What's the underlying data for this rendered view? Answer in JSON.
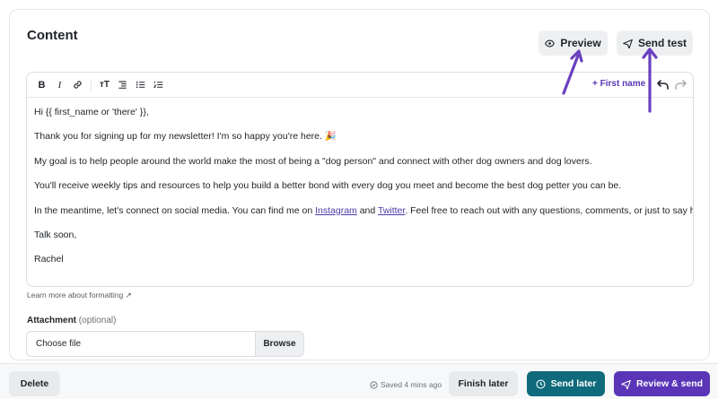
{
  "section": {
    "title": "Content"
  },
  "header_buttons": {
    "preview": "Preview",
    "send_test": "Send test"
  },
  "toolbar": {
    "bold": "B",
    "italic": "I",
    "text_size": "тT",
    "personalize": "+ First name"
  },
  "editor": {
    "paragraphs": [
      "Hi {{ first_name or 'there' }},",
      "Thank you for signing up for my newsletter! I'm so happy you're here. 🎉",
      "My goal is to help people around the world make the most of being a \"dog person\" and connect with other dog owners and dog lovers.",
      "You'll receive weekly tips and resources to help you build a better bond with every dog you meet and become the best dog petter you can be.",
      "Talk soon,",
      "Rachel"
    ],
    "social_line": {
      "before": "In the meantime, let's connect on social media. You can find me on ",
      "link1": "Instagram",
      "between": " and ",
      "link2": "Twitter",
      "after": ". Feel free to reach out with any questions, comments, or just to say hi."
    }
  },
  "learn_more": "Learn more about formatting ↗",
  "attachment": {
    "label": "Attachment",
    "optional": "(optional)",
    "file_placeholder": "Choose file",
    "browse": "Browse"
  },
  "footer": {
    "delete": "Delete",
    "saved_status": "Saved 4 mins ago",
    "finish_later": "Finish later",
    "send_later": "Send later",
    "review_send": "Review & send"
  },
  "colors": {
    "accent": "#5a35b8",
    "teal": "#0f6b7c",
    "annotation_arrow": "#6a40c0"
  },
  "icons": [
    "eye-icon",
    "send-icon",
    "link-icon",
    "text-size-icon",
    "align-icon",
    "bullet-list-icon",
    "numbered-list-icon",
    "undo-icon",
    "redo-icon",
    "check-circle-icon",
    "clock-icon"
  ]
}
